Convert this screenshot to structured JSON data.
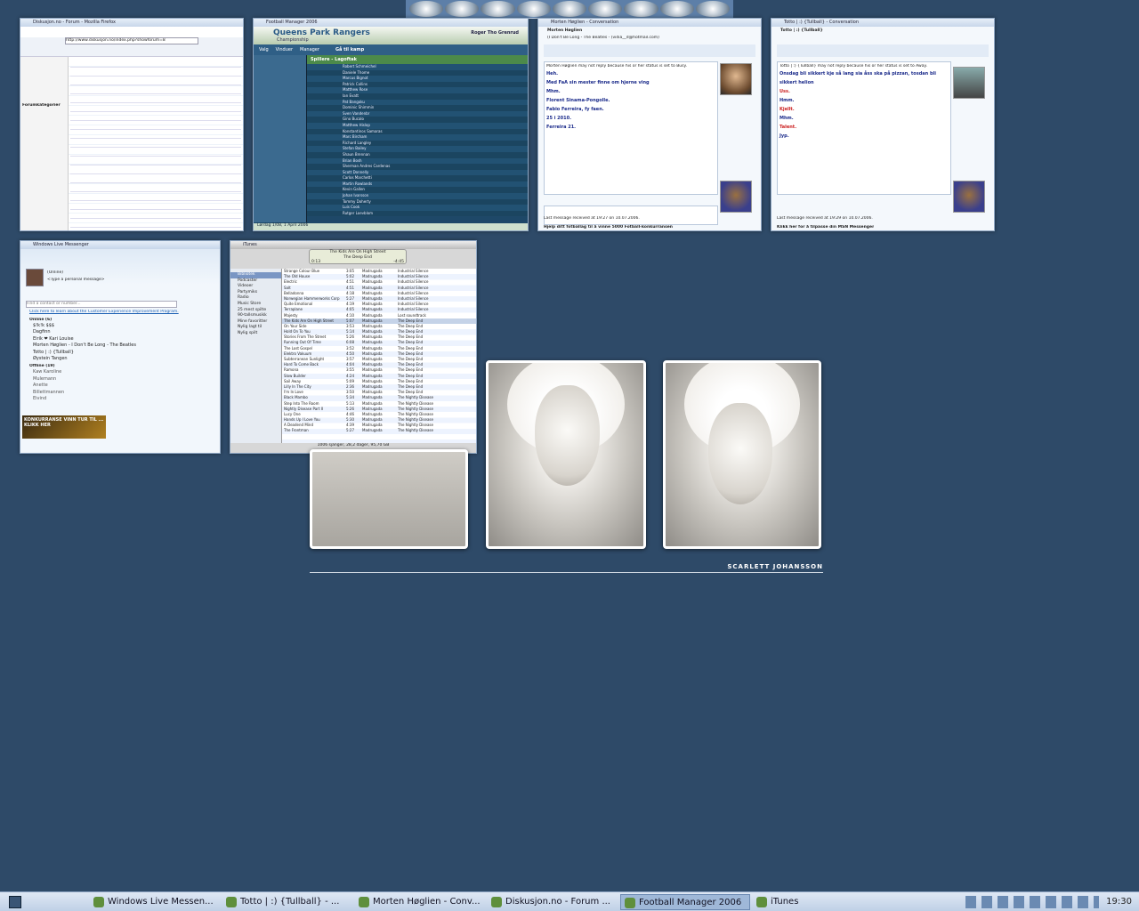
{
  "dock": {
    "icons": [
      "media-icon",
      "bird-icon",
      "headset-icon",
      "bird2-icon",
      "warning-icon",
      "info-icon",
      "halflife-icon",
      "fm-icon",
      "football-icon"
    ]
  },
  "browser": {
    "title": "Diskusjon.no - Forum - Mozilla Firefox",
    "url": "http://www.diskusjon.no/index.php?showforum=8",
    "sidebar_heading": "Forumkategorier"
  },
  "fm": {
    "title": "Football Manager 2006",
    "club": "Queens Park Rangers",
    "subtitle": "Championship",
    "manager": "Roger Tho Grenrud",
    "menu": [
      "Valg",
      "Vinduer",
      "Manager"
    ],
    "goto": "Gå til kamp",
    "panel": "Spillere - Lagoftak",
    "date": "Lørdag 1/08, 1 April 2006",
    "players": [
      "Robert Schmeichel",
      "Daniele Thome",
      "Marcus Bignot",
      "Patrick Collins",
      "Matthew Rose",
      "Ian Evatt",
      "Pat Bangoku",
      "Dominic Shimmin",
      "Sven Vandenbr",
      "Gino Bucalo",
      "Matthew Hislop",
      "Konstantinos Samaras",
      "Marc Bircham",
      "Richard Langley",
      "Stefan Bailey",
      "Shaun Brennan",
      "Brian Bosh",
      "Sherman Andres Cardenas",
      "Scott Donnelly",
      "Carlos Marchetti",
      "Martin Rowlands",
      "Kevin Gallen",
      "Johan Ivarsson",
      "Tommy Doherty",
      "Luis Cook",
      "Rutger Loevblom"
    ]
  },
  "conv1": {
    "title": "Morten Høglien - Conversation",
    "name": "Morten Høglien",
    "status": "(I Don't Be Long - The Beatles - (vidia__d@hotmail.com)",
    "notice": "Morten Høglien may not reply because his or her status is set to Busy.",
    "messages": [
      "Heh.",
      "Med FaA sin mester finne om hjerne ving",
      "Mhm.",
      "Florent Sinama-Pongolle.",
      "Fabio Ferreira, fy faen.",
      "25 i 2010.",
      "Ferreira 21."
    ],
    "last": "Last message received at 19:27 on 10.07.2006.",
    "footer": "Hjelp ditt fotballag til å vinne 5000 Fotball-konkurransen"
  },
  "conv2": {
    "title": "Totto | :) {Tullball} - Conversation",
    "name": "Totto | :) {Tullball}",
    "notice": "Totto | :) {Tullball} may not reply because his or her status is set to Away.",
    "messages": [
      "Onsdag bli sikkert kje så lang sia åss ska på pizzan, tosdan bli sikkert helion",
      "Uss.",
      "Hmm.",
      "Kjellt.",
      "Mhm.",
      "Talent.",
      "Jyp."
    ],
    "last": "Last message received at 19:29 on 10.07.2006.",
    "footer": "Klikk her for å tilpasse din MSN Messenger"
  },
  "wlm": {
    "title": "Windows Live Messenger",
    "me": "(Online)",
    "personal": "<Type a personal message>",
    "search": "Find a contact or number...",
    "banner": "Click here to learn about the Customer Experience Improvement Program.",
    "online_label": "Online (6)",
    "offline_label": "Offline (19)",
    "online": [
      "$!k!k $$$",
      "Dagfinn",
      "Eirik ❤ Kari Louise",
      "Morten Høglien - I Don't Be Long - The Beatles",
      "Totto | :) {Tullball}",
      "Øystein Tangen"
    ],
    "offline": [
      "Kaw Karoline",
      "Mulemann",
      "Anette",
      "Billettmannen",
      "Eivind"
    ],
    "ad": "KONKURRANSE VINN TUR TIL ... KLIKK HER"
  },
  "itunes": {
    "title": "iTunes",
    "now_playing": "The Kids Are On High Street",
    "artist": "The Deep End",
    "time_left": "0:13",
    "time_right": "-4:45",
    "status": "1006 sjanger, 28,2 dager, 95,70 GB",
    "sources": [
      "Bibliotek",
      "Podcaster",
      "Videoer",
      "Partymiks",
      "Radio",
      "Music Store",
      "25 mest spilte",
      "90-tallsmusikk",
      "Mine favoritter",
      "Nylig lagt til",
      "Nylig spilt"
    ],
    "tracks": [
      [
        "Strange Colour Blue",
        "3:05",
        "Madrugada",
        "Industrial Silence"
      ],
      [
        "The Old House",
        "5:02",
        "Madrugada",
        "Industrial Silence"
      ],
      [
        "Electric",
        "4:51",
        "Madrugada",
        "Industrial Silence"
      ],
      [
        "Salt",
        "4:51",
        "Madrugada",
        "Industrial Silence"
      ],
      [
        "Belladonna",
        "4:18",
        "Madrugada",
        "Industrial Silence"
      ],
      [
        "Norwegian Hammerworks Corp",
        "5:27",
        "Madrugada",
        "Industrial Silence"
      ],
      [
        "Quite Emotional",
        "4:19",
        "Madrugada",
        "Industrial Silence"
      ],
      [
        "Terraplane",
        "4:05",
        "Madrugada",
        "Industrial Silence"
      ],
      [
        "Majesty",
        "4:10",
        "Madrugada",
        "Lost soundtrack"
      ],
      [
        "The Kids Are On High Street",
        "5:07",
        "Madrugada",
        "The Deep End"
      ],
      [
        "On Your Side",
        "3:53",
        "Madrugada",
        "The Deep End"
      ],
      [
        "Hold On To You",
        "5:14",
        "Madrugada",
        "The Deep End"
      ],
      [
        "Stories From The Street",
        "5:26",
        "Madrugada",
        "The Deep End"
      ],
      [
        "Running Out Of Time",
        "6:08",
        "Madrugada",
        "The Deep End"
      ],
      [
        "The Lost Gospel",
        "3:52",
        "Madrugada",
        "The Deep End"
      ],
      [
        "Elektro Vakuum",
        "4:50",
        "Madrugada",
        "The Deep End"
      ],
      [
        "Subterranean Sunlight",
        "3:57",
        "Madrugada",
        "The Deep End"
      ],
      [
        "Hard To Come Back",
        "4:04",
        "Madrugada",
        "The Deep End"
      ],
      [
        "Ramona",
        "3:55",
        "Madrugada",
        "The Deep End"
      ],
      [
        "Slow Builder",
        "4:24",
        "Madrugada",
        "The Deep End"
      ],
      [
        "Sail Away",
        "5:09",
        "Madrugada",
        "The Deep End"
      ],
      [
        "Lilly In The City",
        "2:36",
        "Madrugada",
        "The Deep End"
      ],
      [
        "I'm In Love",
        "3:50",
        "Madrugada",
        "The Deep End"
      ],
      [
        "Black Mambo",
        "5:34",
        "Madrugada",
        "The Nightly Disease"
      ],
      [
        "Step Into The Room",
        "5:13",
        "Madrugada",
        "The Nightly Disease"
      ],
      [
        "Nightly Disease Part II",
        "5:26",
        "Madrugada",
        "The Nightly Disease"
      ],
      [
        "Lucy One",
        "4:46",
        "Madrugada",
        "The Nightly Disease"
      ],
      [
        "Hands Up I Love You",
        "5:30",
        "Madrugada",
        "The Nightly Disease"
      ],
      [
        "A Deadend Mind",
        "4:39",
        "Madrugada",
        "The Nightly Disease"
      ],
      [
        "The Frontman",
        "5:27",
        "Madrugada",
        "The Nightly Disease"
      ]
    ]
  },
  "caption": "SCARLETT JOHANSSON",
  "taskbar": {
    "buttons": [
      "Windows Live Messen...",
      "Totto | :) {Tullball} - ...",
      "Morten Høglien - Conv...",
      "Diskusjon.no - Forum ...",
      "Football Manager 2006",
      "iTunes"
    ],
    "clock": "19:30"
  }
}
